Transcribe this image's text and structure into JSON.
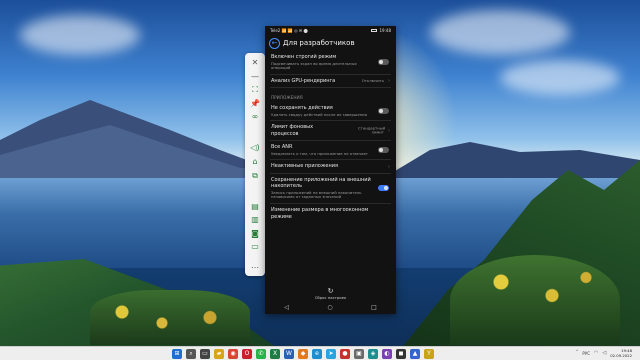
{
  "phone": {
    "status_left": "Tele2 📶 📶 ◎ ✉ ⬤",
    "status_time": "19:48",
    "back_icon": "back-arrow-icon",
    "title": "Для разработчиков",
    "rows_top": [
      {
        "title": "Включен строгий режим",
        "subtitle": "Подсвечивать экран во время длительных операций",
        "control": "toggle",
        "on": false
      },
      {
        "title": "Анализ GPU-рендеринга",
        "value": "Отключить",
        "control": "chevron"
      }
    ],
    "section_apps": "ПРИЛОЖЕНИЯ",
    "rows_apps": [
      {
        "title": "Не сохранять действия",
        "subtitle": "Удалять сводку действий после их завершения",
        "control": "toggle",
        "on": false
      },
      {
        "title": "Лимит фоновых процессов",
        "value": "Стандартный лимит",
        "control": "chevron"
      },
      {
        "title": "Все ANR",
        "subtitle": "Уведомлять о том, что приложение не отвечает",
        "control": "toggle",
        "on": false
      },
      {
        "title": "Неактивные приложения",
        "control": "chevron"
      },
      {
        "title": "Сохранение приложений на внешний накопитель",
        "subtitle": "Запись приложений на внешний накопитель независимо от заданных значений",
        "control": "toggle",
        "on": true
      },
      {
        "title": "Изменение размера в многооконном режиме",
        "control": "none"
      }
    ],
    "reset_label": "Сброс настроек",
    "nav": [
      "◁",
      "○",
      "□"
    ]
  },
  "toolbar_icons": [
    "close-icon",
    "minimize-icon",
    "fullscreen-icon",
    "pin-icon",
    "link-icon",
    "volume-icon",
    "home-icon",
    "multitask-icon",
    "screenshot-icon",
    "files-icon",
    "camera-icon",
    "folder-icon",
    "more-icon"
  ],
  "taskbar": {
    "icons": [
      {
        "name": "start",
        "color": "#1f6fd1",
        "glyph": "⊞"
      },
      {
        "name": "search",
        "color": "#555555",
        "glyph": "⌕"
      },
      {
        "name": "task-view",
        "color": "#444444",
        "glyph": "▭"
      },
      {
        "name": "explorer",
        "color": "#d8a41a",
        "glyph": "▰"
      },
      {
        "name": "chrome",
        "color": "#d94436",
        "glyph": "◉"
      },
      {
        "name": "opera",
        "color": "#cc1f2d",
        "glyph": "O"
      },
      {
        "name": "whatsapp",
        "color": "#28b24a",
        "glyph": "✆"
      },
      {
        "name": "excel",
        "color": "#1f7a44",
        "glyph": "X"
      },
      {
        "name": "word",
        "color": "#2b5fb4",
        "glyph": "W"
      },
      {
        "name": "app-orange",
        "color": "#e07a1f",
        "glyph": "◆"
      },
      {
        "name": "edge",
        "color": "#1d8fd1",
        "glyph": "e"
      },
      {
        "name": "telegram",
        "color": "#2aa3df",
        "glyph": "➤"
      },
      {
        "name": "app-red",
        "color": "#c4302b",
        "glyph": "●"
      },
      {
        "name": "app-gray",
        "color": "#6a6a6a",
        "glyph": "▣"
      },
      {
        "name": "app-teal",
        "color": "#1c8e8e",
        "glyph": "◈"
      },
      {
        "name": "app-purple",
        "color": "#7a3fb0",
        "glyph": "◐"
      },
      {
        "name": "app-dark",
        "color": "#333333",
        "glyph": "◼"
      },
      {
        "name": "app-blue",
        "color": "#3366cc",
        "glyph": "▲"
      },
      {
        "name": "app-yellow",
        "color": "#c8a418",
        "glyph": "Y"
      }
    ],
    "tray": {
      "lang": "РУС",
      "time": "19:48",
      "date": "02.09.2022"
    }
  }
}
